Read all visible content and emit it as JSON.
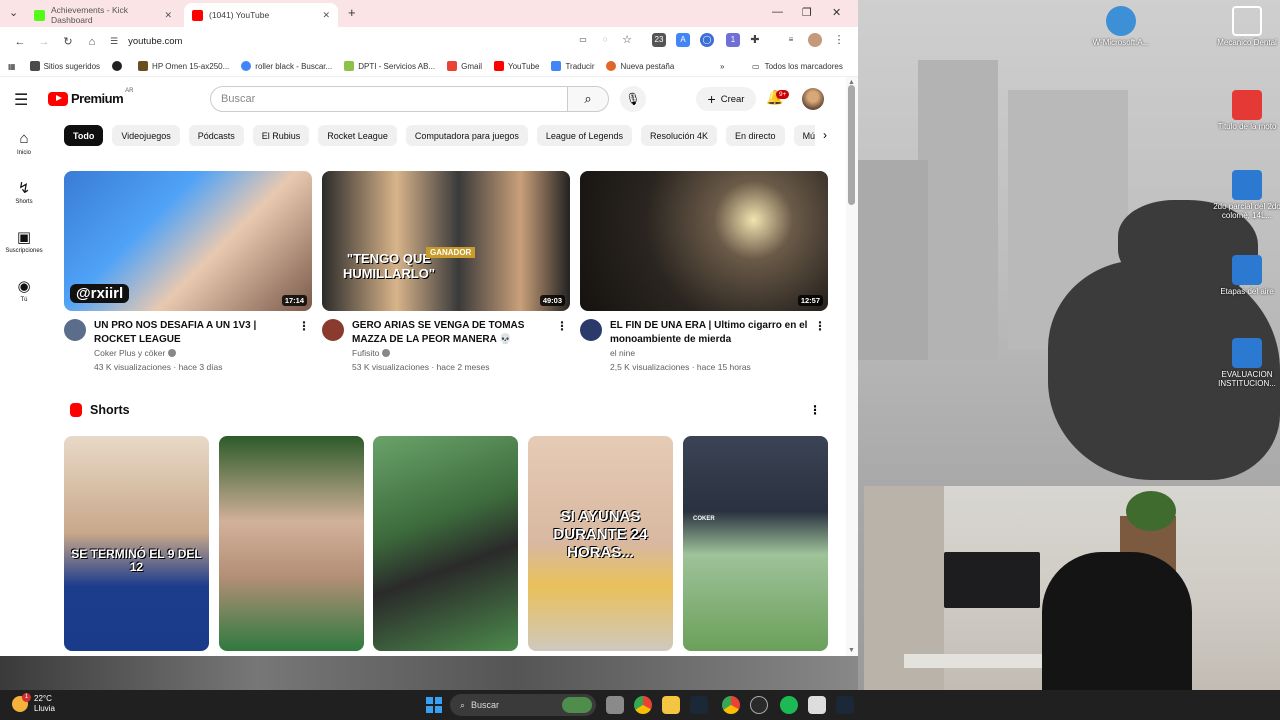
{
  "browser": {
    "tabs": [
      {
        "title": "Achievements - Kick Dashboard",
        "favicon_color": "#53fc18"
      },
      {
        "title": "(1041) YouTube",
        "favicon_color": "#ff0000"
      }
    ],
    "new_tab": "+",
    "url": "youtube.com",
    "bookmarks": [
      {
        "label": "Sitios sugeridos",
        "color": "#4a4a4a"
      },
      {
        "label": "",
        "color": "#222222"
      },
      {
        "label": "HP Omen 15-ax250...",
        "color": "#6a4e1e"
      },
      {
        "label": "roller black - Buscar...",
        "color": "#4285f4"
      },
      {
        "label": "DPTI - Servicios AB...",
        "color": "#8bc34a"
      },
      {
        "label": "Gmail",
        "color": "#ea4335"
      },
      {
        "label": "YouTube",
        "color": "#ff0000"
      },
      {
        "label": "Traducir",
        "color": "#4285f4"
      },
      {
        "label": "Nueva pestaña",
        "color": "#e0662a"
      }
    ],
    "bookmarks_more": "»",
    "all_bookmarks": "Todos los marcadores"
  },
  "youtube": {
    "logo_word": "Premium",
    "logo_region": "AR",
    "search_placeholder": "Buscar",
    "create_label": "Crear",
    "notif_badge": "9+",
    "guide": [
      {
        "icon": "⌂",
        "label": "Inicio"
      },
      {
        "icon": "↯",
        "label": "Shorts"
      },
      {
        "icon": "▣",
        "label": "Suscripciones"
      },
      {
        "icon": "◉",
        "label": "Tú"
      }
    ],
    "chips": [
      "Todo",
      "Videojuegos",
      "Pódcasts",
      "El Rubius",
      "Rocket League",
      "Computadora para juegos",
      "League of Legends",
      "Resolución 4K",
      "En directo",
      "Músic"
    ],
    "videos": [
      {
        "title": "UN PRO NOS DESAFIA A UN 1V3 | ROCKET LEAGUE",
        "channel": "Coker Plus y cöker",
        "stats": "43 K visualizaciones · hace 3 días",
        "duration": "17:14",
        "thumb_text": "@rxiirl",
        "avatar_color": "#5b6d8a"
      },
      {
        "title": "GERO ARIAS SE VENGA DE TOMAS MAZZA DE LA PEOR MANERA 💀",
        "channel": "Fufisito",
        "stats": "53 K visualizaciones · hace 2 meses",
        "duration": "49:03",
        "thumb_text_1": "\"TENGO QUE HUMILLARLO\"",
        "thumb_text_2": "GANADOR",
        "avatar_color": "#8a3b2e"
      },
      {
        "title": "EL FIN DE UNA ERA | Ultimo cigarro en el monoambiente de mierda",
        "channel": "el nine",
        "stats": "2,5 K visualizaciones · hace 15 horas",
        "duration": "12:57",
        "avatar_color": "#2b3a6b"
      }
    ],
    "shorts_title": "Shorts",
    "shorts": [
      {
        "caption": "SE TERMINÓ EL 9 DEL 12"
      },
      {
        "caption": ""
      },
      {
        "caption": ""
      },
      {
        "caption": "SI AYUNAS DURANTE 24 HORAS..."
      },
      {
        "caption": "COKER"
      }
    ]
  },
  "desktop": {
    "icons": [
      {
        "label": "W-Microsoft.A...",
        "color": "#3d8fd6"
      },
      {
        "label": "Mecanico Dental",
        "color": "#ffffff"
      },
      {
        "label": "Titulo de la moto",
        "color": "#e53935"
      },
      {
        "label": "2do parcial del 2do colomé, 14L...",
        "color": "#2b79d0"
      },
      {
        "label": "Etapas del aire",
        "color": "#2b79d0"
      },
      {
        "label": "EVALUACION INSTITUCION...",
        "color": "#2b79d0"
      }
    ]
  },
  "taskbar": {
    "temperature": "22°C",
    "condition": "Lluvia",
    "weather_badge": "1",
    "search_label": "Buscar"
  }
}
